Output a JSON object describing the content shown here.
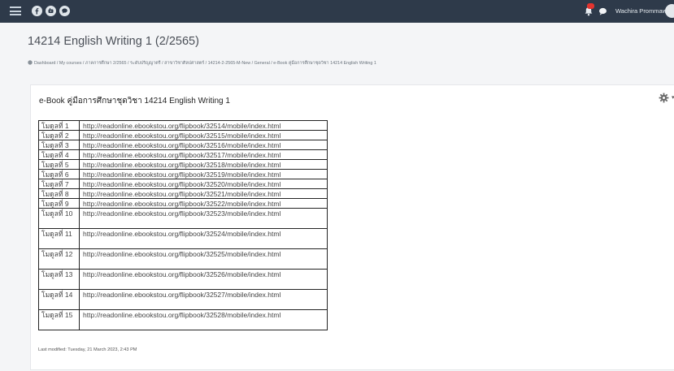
{
  "topbar": {
    "user_name": "Wachira Prommawong",
    "icons": [
      "menu-icon",
      "facebook-icon",
      "youtube-icon",
      "chat-icon",
      "notification-bell-icon",
      "message-icon"
    ],
    "accent_color": "#2e3a4a",
    "badge_color": "#e3342f"
  },
  "page": {
    "course_title": "14214 English Writing 1 (2/2565)",
    "breadcrumb": "Dashboard / My courses / ภาคการศึกษา 2/2565 / ระดับปริญญาตรี / สาขาวิชาศิลปศาสตร์ / 14214-2-2565-M-New / General / e-Book คู่มือการศึกษาชุดวิชา 14214 English Writing 1"
  },
  "ebook": {
    "title": "e-Book คู่มือการศึกษาชุดวิชา 14214 English Writing 1",
    "rows": [
      {
        "label": "โมดูลที่ 1",
        "url": "http://readonline.ebookstou.org/flipbook/32514/mobile/index.html"
      },
      {
        "label": "โมดูลที่ 2",
        "url": "http://readonline.ebookstou.org/flipbook/32515/mobile/index.html"
      },
      {
        "label": "โมดูลที่ 3",
        "url": "http://readonline.ebookstou.org/flipbook/32516/mobile/index.html"
      },
      {
        "label": "โมดูลที่ 4",
        "url": "http://readonline.ebookstou.org/flipbook/32517/mobile/index.html"
      },
      {
        "label": "โมดูลที่ 5",
        "url": "http://readonline.ebookstou.org/flipbook/32518/mobile/index.html"
      },
      {
        "label": "โมดูลที่ 6",
        "url": "http://readonline.ebookstou.org/flipbook/32519/mobile/index.html"
      },
      {
        "label": "โมดูลที่ 7",
        "url": "http://readonline.ebookstou.org/flipbook/32520/mobile/index.html"
      },
      {
        "label": "โมดูลที่ 8",
        "url": "http://readonline.ebookstou.org/flipbook/32521/mobile/index.html"
      },
      {
        "label": "โมดูลที่ 9",
        "url": "http://readonline.ebookstou.org/flipbook/32522/mobile/index.html"
      },
      {
        "label": "โมดูลที่ 10",
        "url": "http://readonline.ebookstou.org/flipbook/32523/mobile/index.html"
      },
      {
        "label": "โมดูลที่ 11",
        "url": "http://readonline.ebookstou.org/flipbook/32524/mobile/index.html"
      },
      {
        "label": "โมดูลที่ 12",
        "url": "http://readonline.ebookstou.org/flipbook/32525/mobile/index.html"
      },
      {
        "label": "โมดูลที่ 13",
        "url": "http://readonline.ebookstou.org/flipbook/32526/mobile/index.html"
      },
      {
        "label": "โมดูลที่ 14",
        "url": "http://readonline.ebookstou.org/flipbook/32527/mobile/index.html"
      },
      {
        "label": "โมดูลที่ 15",
        "url": "http://readonline.ebookstou.org/flipbook/32528/mobile/index.html"
      }
    ],
    "last_modified": "Last modified: Tuesday, 21 March 2023, 2:43 PM"
  }
}
